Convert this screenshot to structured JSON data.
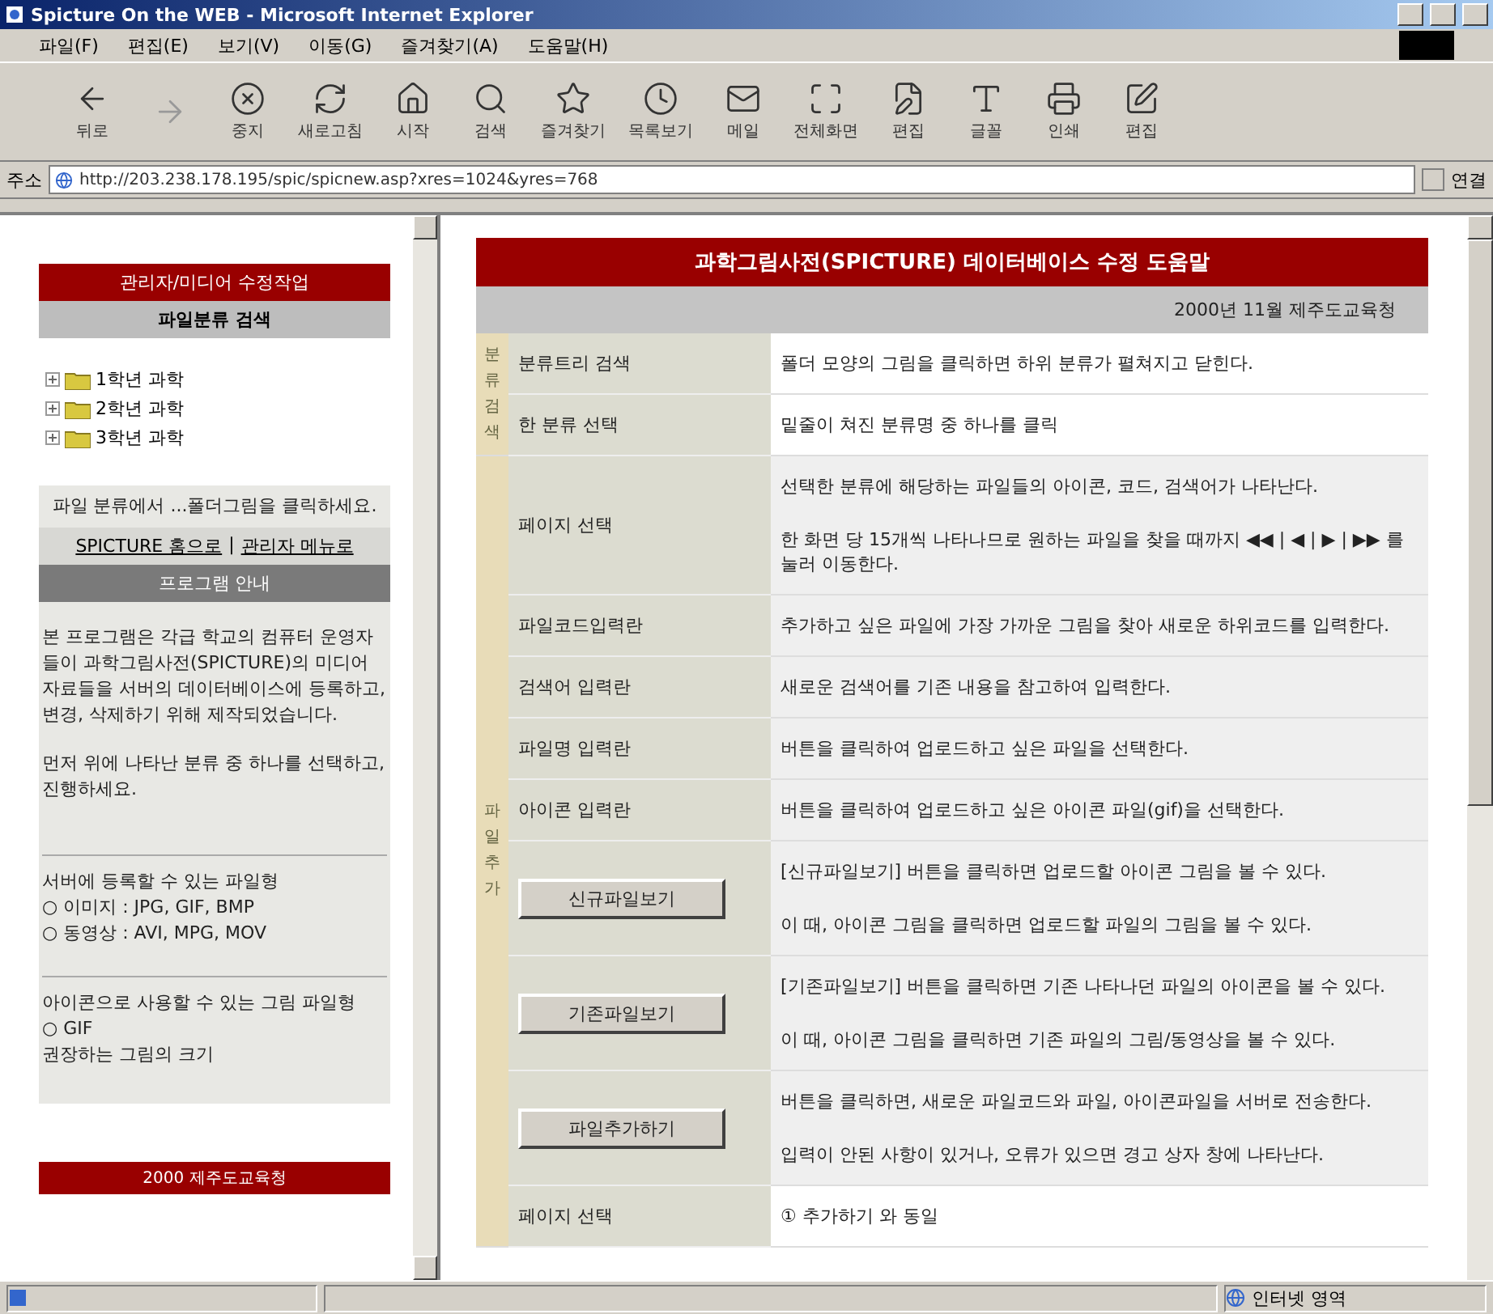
{
  "window": {
    "title": "Spicture On the WEB - Microsoft Internet Explorer"
  },
  "menu": [
    "파일(F)",
    "편집(E)",
    "보기(V)",
    "이동(G)",
    "즐겨찾기(A)",
    "도움말(H)"
  ],
  "toolbar": [
    {
      "label": "뒤로",
      "disabled": false
    },
    {
      "disabled": true
    },
    {
      "label": "중지",
      "disabled": false
    },
    {
      "label": "새로고침",
      "disabled": false
    },
    {
      "label": "시작",
      "disabled": false
    },
    {
      "label": "검색",
      "disabled": false
    },
    {
      "label": "즐겨찾기",
      "disabled": false
    },
    {
      "label": "목록보기",
      "disabled": false
    },
    {
      "label": "메일",
      "disabled": false
    },
    {
      "label": "전체화면",
      "disabled": false
    },
    {
      "label": "편집",
      "disabled": false
    },
    {
      "label": "글꼴",
      "disabled": false
    },
    {
      "label": "인쇄",
      "disabled": false
    },
    {
      "label": "편집",
      "disabled": false
    }
  ],
  "address": {
    "label": "주소",
    "url": "http://203.238.178.195/spic/spicnew.asp?xres=1024&yres=768",
    "go": "연결"
  },
  "left_frame": {
    "title": "관리자/미디어 수정작업",
    "search_heading": "파일분류 검색",
    "tree": [
      {
        "label": "1학년 과학",
        "expanded": false
      },
      {
        "label": "2학년 과학",
        "expanded": false
      },
      {
        "label": "3학년 과학",
        "expanded": false
      }
    ],
    "hint": "파일 분류에서 ...폴더그림을 클릭하세요.",
    "links": [
      "SPICTURE 홈으로",
      "관리자 메뉴로"
    ],
    "link_separator": "|",
    "guide_heading": "프로그램 안내",
    "guide": [
      {
        "paragraphs": [
          "본 프로그램은 각급 학교의 컴퓨터 운영자들이 과학그림사전(SPICTURE)의 미디어 자료들을 서버의 데이터베이스에 등록하고, 변경, 삭제하기 위해 제작되었습니다.",
          "먼저 위에 나타난 분류 중 하나를 선택하고, 진행하세요."
        ]
      },
      {
        "paragraphs": [
          "서버에 등록할 수 있는 파일형",
          "○ 이미지 : JPG, GIF, BMP",
          "○ 동영상 : AVI, MPG, MOV"
        ]
      },
      {
        "paragraphs": [
          "아이콘으로 사용할 수 있는 그림 파일형",
          "○ GIF",
          "권장하는 그림의 크기"
        ]
      }
    ],
    "footer": "2000 제주도교육청"
  },
  "main": {
    "title": "과학그림사전(SPICTURE) 데이터베이스 수정 도움말",
    "date": "2000년 11월 제주도교육청",
    "sections": [
      {
        "label": "분류검색",
        "rows": [
          {
            "kind": "label",
            "label": "분류트리 검색",
            "shaded": false,
            "lines": [
              "폴더 모양의 그림을 클릭하면 하위 분류가 펼쳐지고 닫힌다."
            ]
          },
          {
            "kind": "label",
            "label": "한 분류 선택",
            "shaded": false,
            "lines": [
              "밑줄이 쳐진 분류명 중 하나를 클릭"
            ]
          }
        ]
      },
      {
        "label": "파일추가",
        "rows": [
          {
            "kind": "label",
            "label": "페이지 선택",
            "shaded": true,
            "lines": [
              "선택한 분류에 해당하는 파일들의 아이콘, 코드, 검색어가 나타난다.",
              "한 화면 당 15개씩 나타나므로 원하는 파일을 찾을 때까지 ◀◀ | ◀ | ▶ | ▶▶ 를 눌러 이동한다."
            ]
          },
          {
            "kind": "label",
            "label": "파일코드입력란",
            "shaded": true,
            "lines": [
              "추가하고 싶은 파일에 가장 가까운 그림을 찾아 새로운 하위코드를 입력한다."
            ]
          },
          {
            "kind": "label",
            "label": "검색어 입력란",
            "shaded": true,
            "lines": [
              "새로운 검색어를 기존 내용을 참고하여 입력한다."
            ]
          },
          {
            "kind": "label",
            "label": "파일명 입력란",
            "shaded": true,
            "lines": [
              "버튼을 클릭하여 업로드하고 싶은 파일을 선택한다."
            ]
          },
          {
            "kind": "label",
            "label": "아이콘 입력란",
            "shaded": true,
            "lines": [
              "버튼을 클릭하여 업로드하고 싶은 아이콘 파일(gif)을 선택한다."
            ]
          },
          {
            "kind": "button",
            "label": "신규파일보기",
            "shaded": true,
            "lines": [
              "[신규파일보기] 버튼을 클릭하면 업로드할 아이콘 그림을 볼 수 있다.",
              "이 때, 아이콘 그림을 클릭하면 업로드할 파일의 그림을 볼 수 있다."
            ]
          },
          {
            "kind": "button",
            "label": "기존파일보기",
            "shaded": true,
            "lines": [
              "[기존파일보기] 버튼을 클릭하면 기존 나타나던 파일의 아이콘을 볼 수 있다.",
              "이 때, 아이콘 그림을 클릭하면 기존 파일의 그림/동영상을 볼 수 있다."
            ]
          },
          {
            "kind": "button",
            "label": "파일추가하기",
            "shaded": true,
            "lines": [
              "버튼을 클릭하면, 새로운 파일코드와 파일, 아이콘파일을 서버로 전송한다.",
              "입력이 안된 사항이 있거나, 오류가 있으면 경고 상자 창에 나타난다."
            ]
          },
          {
            "kind": "label",
            "label": "페이지 선택",
            "shaded": false,
            "lines": [
              "① 추가하기 와 동일"
            ]
          }
        ]
      }
    ]
  },
  "status_bar": {
    "zone": "인터넷 영역"
  }
}
